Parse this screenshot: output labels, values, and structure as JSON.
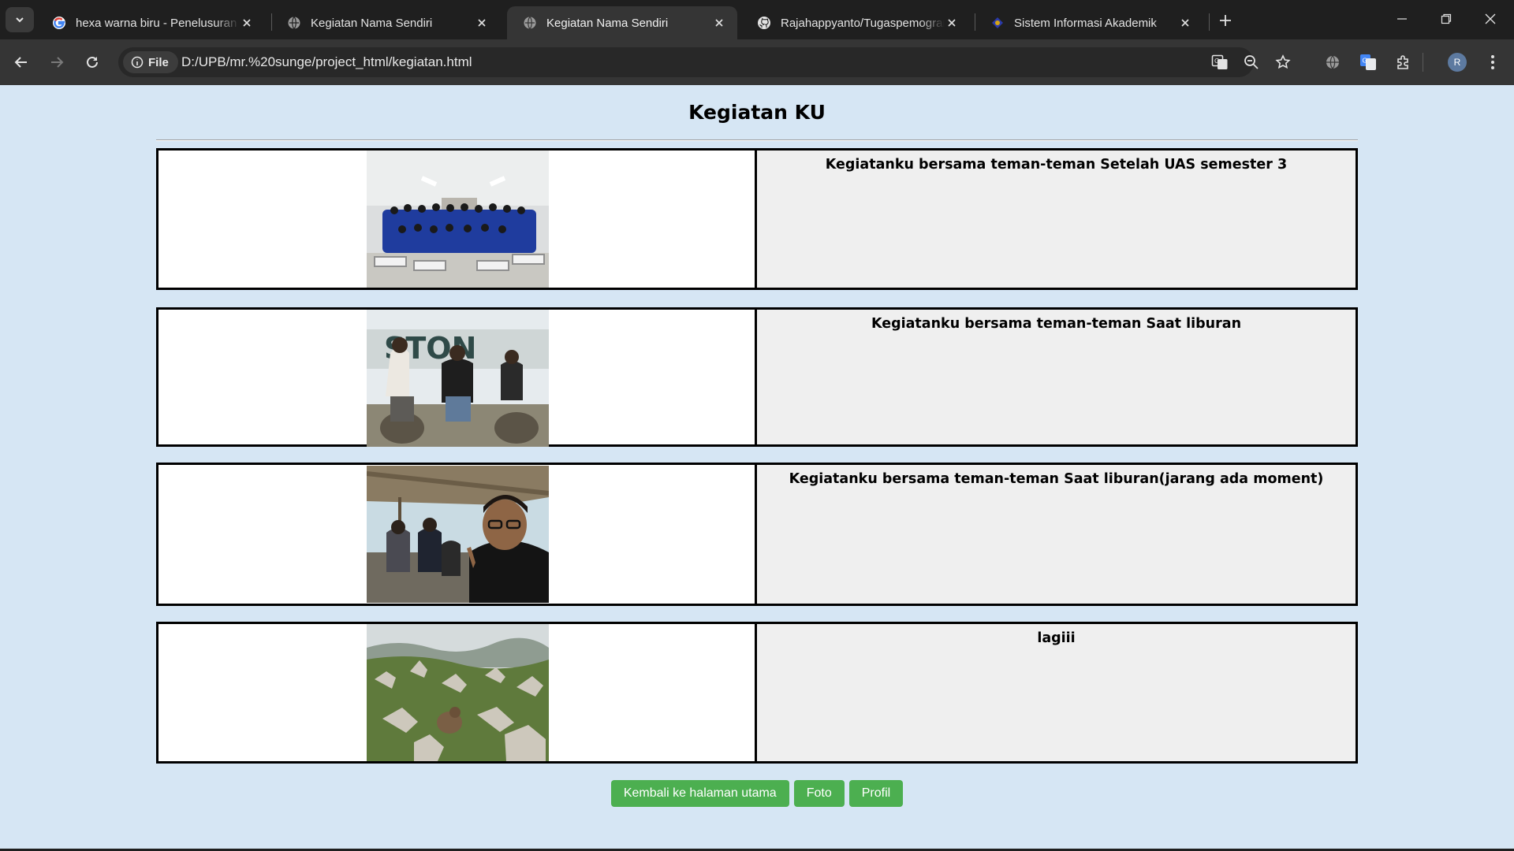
{
  "browser": {
    "tabs": [
      {
        "title": "hexa warna biru - Penelusuran Google",
        "favicon": "google-icon",
        "active": false
      },
      {
        "title": "Kegiatan Nama Sendiri",
        "favicon": "globe-icon",
        "active": false
      },
      {
        "title": "Kegiatan Nama Sendiri",
        "favicon": "globe-icon",
        "active": true
      },
      {
        "title": "Rajahappyanto/Tugaspemograman",
        "favicon": "github-icon",
        "active": false
      },
      {
        "title": "Sistem Informasi Akademik",
        "favicon": "academic-icon",
        "active": false
      }
    ],
    "address": {
      "scheme_chip": "File",
      "url": "D:/UPB/mr.%20sunge/project_html/kegiatan.html"
    },
    "profile_initial": "R"
  },
  "page": {
    "title": "Kegiatan KU",
    "activities": [
      {
        "caption": "Kegiatanku bersama teman-teman Setelah UAS semester 3",
        "photo": "group-photo-classroom"
      },
      {
        "caption": "Kegiatanku bersama teman-teman Saat liburan",
        "photo": "friends-sitting-photo"
      },
      {
        "caption": "Kegiatanku bersama teman-teman Saat liburan(jarang ada moment)",
        "photo": "selfie-hut-photo"
      },
      {
        "caption": "lagiii",
        "photo": "rocky-hill-monkey-photo"
      }
    ],
    "buttons": {
      "home": "Kembali ke halaman utama",
      "foto": "Foto",
      "profil": "Profil"
    }
  },
  "colors": {
    "page_bg": "#d6e6f4",
    "button_green": "#4caf50",
    "caption_cell_bg": "#efefef"
  }
}
